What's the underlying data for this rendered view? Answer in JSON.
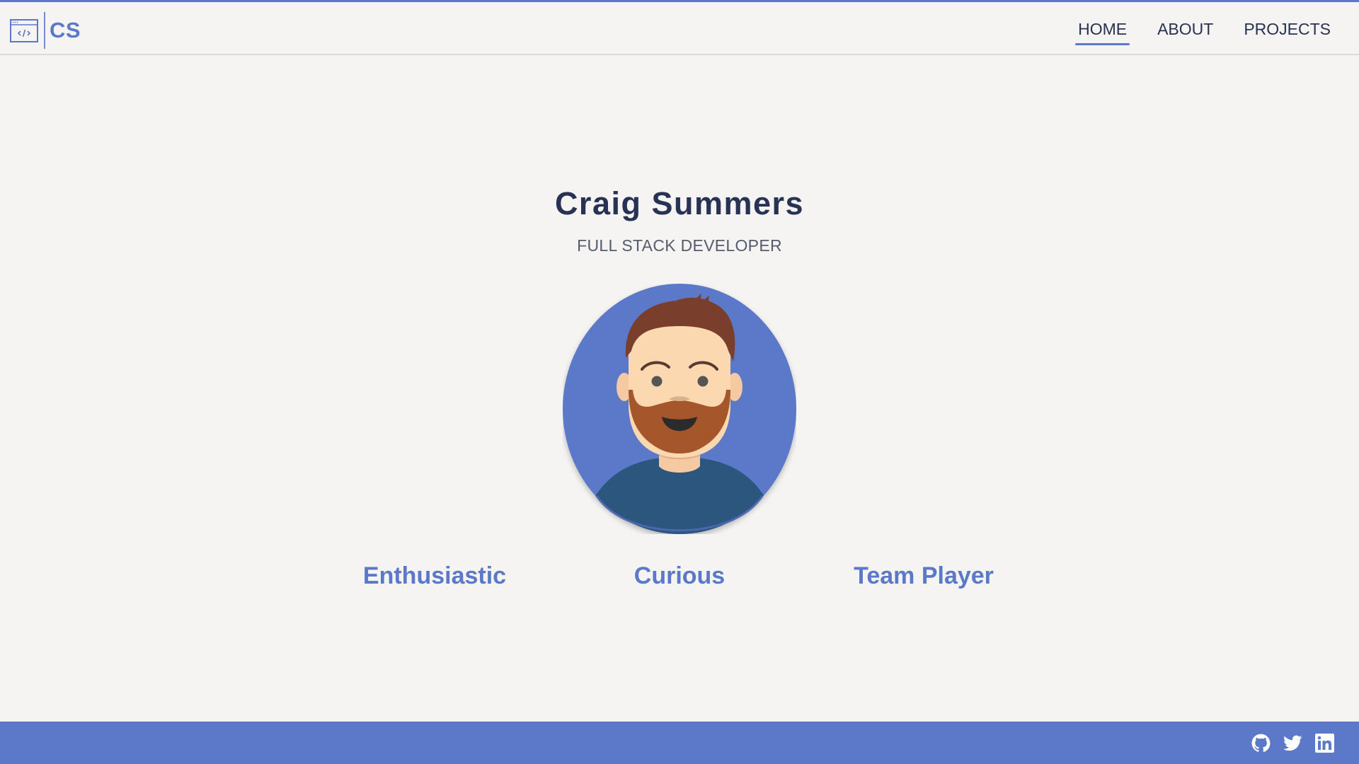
{
  "brand": {
    "logo_text": "CS",
    "logo_icon": "code-window-icon",
    "accent_color": "#5c79c9",
    "text_color": "#283252"
  },
  "nav": {
    "items": [
      {
        "label": "HOME",
        "active": true
      },
      {
        "label": "ABOUT",
        "active": false
      },
      {
        "label": "PROJECTS",
        "active": false
      }
    ]
  },
  "hero": {
    "name": "Craig Summers",
    "role": "FULL STACK DEVELOPER",
    "avatar": "bearded-man-avatar"
  },
  "traits": [
    "Enthusiastic",
    "Curious",
    "Team Player"
  ],
  "footer": {
    "background_color": "#5c79c9",
    "social": [
      {
        "icon": "github-icon"
      },
      {
        "icon": "twitter-icon"
      },
      {
        "icon": "linkedin-icon"
      }
    ]
  }
}
